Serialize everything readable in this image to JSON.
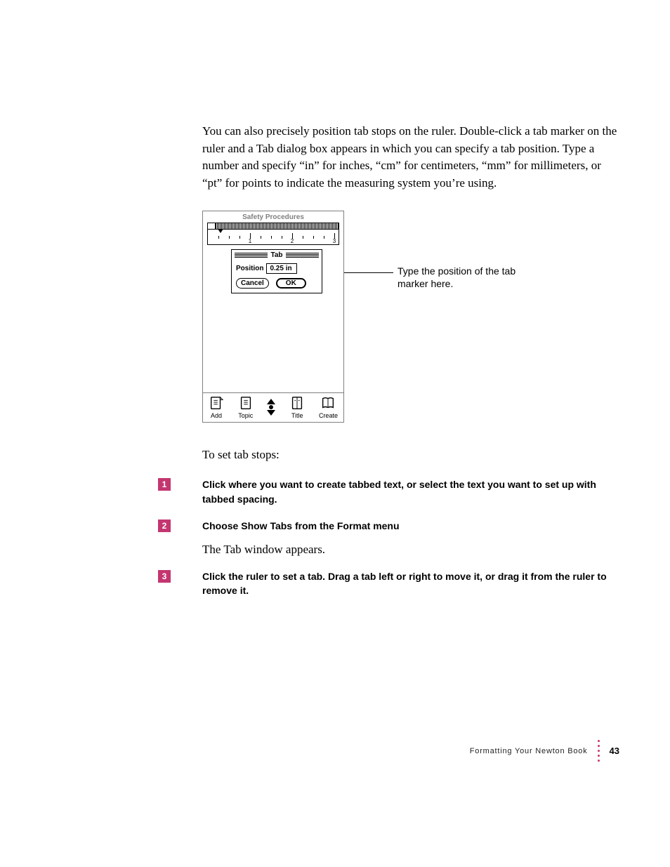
{
  "intro": "You can also precisely position tab stops on the ruler. Double-click a tab marker on the ruler and a Tab dialog box appears in which you can specify a tab position. Type a number and specify “in” for inches, “cm” for centimeters, “mm” for millimeters, or “pt” for points to indicate the measuring system you’re using.",
  "screenshot": {
    "window_title": "Safety Procedures",
    "ruler_numbers": [
      "1",
      "2",
      "3"
    ],
    "dialog": {
      "title": "Tab",
      "position_label": "Position",
      "position_value": "0.25 in",
      "cancel": "Cancel",
      "ok": "OK"
    },
    "toolbar": {
      "add": "Add",
      "topic": "Topic",
      "title": "Title",
      "create": "Create"
    }
  },
  "callout": "Type the position of the tab marker here.",
  "to_set": "To set tab stops:",
  "steps": [
    {
      "num": "1",
      "bold": "Click where you want to create tabbed text, or select the text you want to set up with tabbed spacing."
    },
    {
      "num": "2",
      "bold": "Choose Show Tabs from the Format menu",
      "after": "The Tab window appears."
    },
    {
      "num": "3",
      "bold": "Click the ruler to set a tab. Drag a tab left or right to move it, or drag it from the ruler to remove it."
    }
  ],
  "footer": {
    "title": "Formatting Your Newton Book",
    "page": "43"
  }
}
